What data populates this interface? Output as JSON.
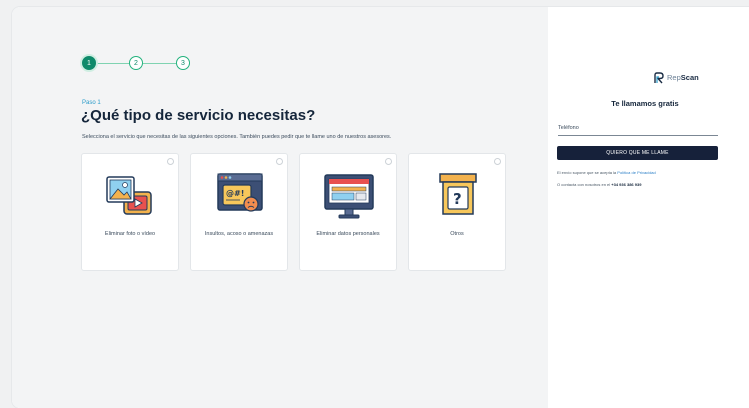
{
  "stepper": {
    "steps": [
      "1",
      "2",
      "3"
    ],
    "active_index": 0,
    "colors": {
      "active": "#0e8a6a",
      "pending_border": "#22b27d",
      "line": "#7fd3b1"
    }
  },
  "main": {
    "step_label": "Paso 1",
    "title": "¿Qué tipo de servicio necesitas?",
    "subtitle": "Selecciona el servicio que necesitas de las siguientes opciones. También puedes pedir que te llame uno de nuestros asesores.",
    "cards": [
      {
        "label": "Eliminar foto o vídeo",
        "icon": "photo-video-icon"
      },
      {
        "label": "Insultos, acoso o amenazas",
        "icon": "insult-chat-icon"
      },
      {
        "label": "Eliminar datos personales",
        "icon": "computer-data-icon"
      },
      {
        "label": "Otros",
        "icon": "question-box-icon"
      }
    ]
  },
  "sidebar": {
    "logo": {
      "part1": "Rep",
      "part2": "Scan",
      "icon": "repscan-logo-icon"
    },
    "heading": "Te llamamos gratis",
    "phone_placeholder": "Teléfono",
    "cta_label": "QUIERO QUE ME LLAME",
    "legal_prefix": "El envío supone que se acepta la",
    "legal_link": "Política de Privacidad",
    "contact_prefix": "O contacta con nosotros en el",
    "contact_phone": "+34 936 386 939"
  },
  "colors": {
    "navy": "#16213a",
    "accent_green": "#0e8a6a",
    "link_blue": "#2a7fc7"
  }
}
